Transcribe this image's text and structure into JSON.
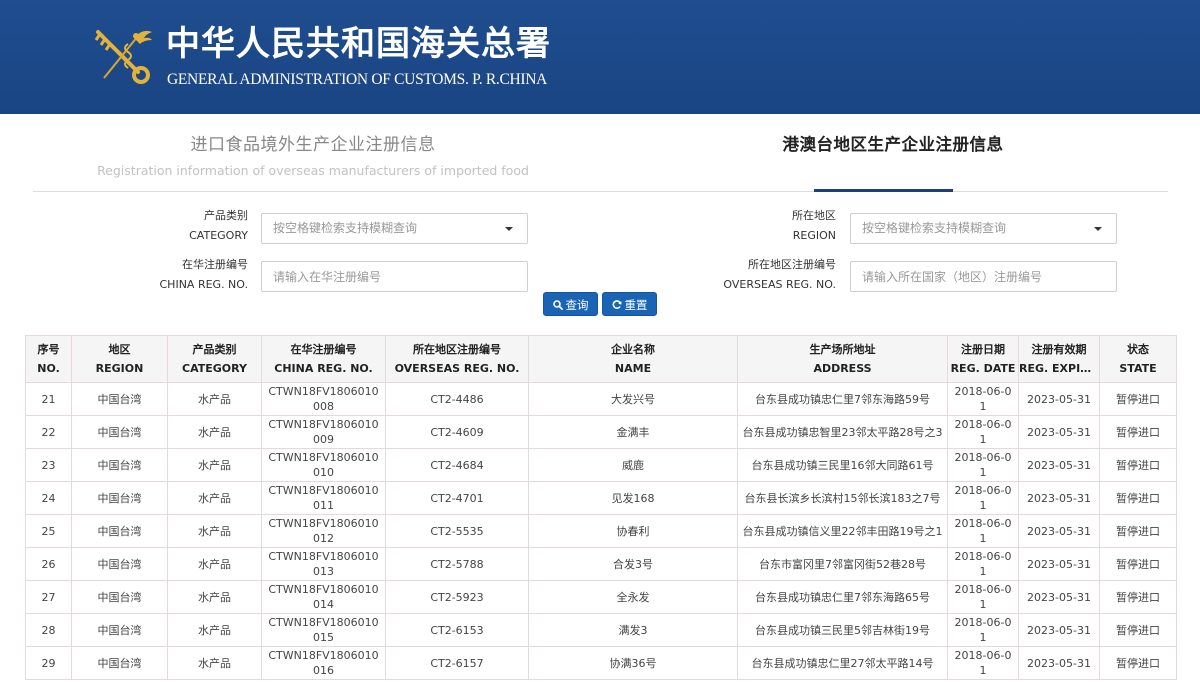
{
  "header": {
    "title_cn": "中华人民共和国海关总署",
    "title_en": "GENERAL ADMINISTRATION OF CUSTOMS. P. R.CHINA",
    "logo": "customs-emblem-icon",
    "colors": {
      "banner": "#1f4d8f",
      "logo_gold": "#e2b23a"
    }
  },
  "tabs": [
    {
      "label_cn": "进口食品境外生产企业注册信息",
      "label_en": "Registration information of overseas manufacturers of imported food",
      "active": false
    },
    {
      "label_cn": "港澳台地区生产企业注册信息",
      "label_en": "",
      "active": true
    }
  ],
  "form": {
    "category": {
      "label_cn": "产品类别",
      "label_en": "CATEGORY",
      "placeholder": "按空格键检索支持模糊查询"
    },
    "region": {
      "label_cn": "所在地区",
      "label_en": "REGION",
      "placeholder": "按空格键检索支持模糊查询"
    },
    "china_reg": {
      "label_cn": "在华注册编号",
      "label_en": "CHINA REG. NO.",
      "placeholder": "请输入在华注册编号",
      "value": ""
    },
    "overseas_reg": {
      "label_cn": "所在地区注册编号",
      "label_en": "OVERSEAS REG. NO.",
      "placeholder": "请输入所在国家（地区）注册编号",
      "value": ""
    },
    "search_button": {
      "label": "查询",
      "icon": "search-icon"
    },
    "reset_button": {
      "label": "重置",
      "icon": "refresh-icon"
    },
    "accent": "#1a64b5"
  },
  "table": {
    "columns": [
      {
        "cn": "序号",
        "en": "NO."
      },
      {
        "cn": "地区",
        "en": "REGION"
      },
      {
        "cn": "产品类别",
        "en": "CATEGORY"
      },
      {
        "cn": "在华注册编号",
        "en": "CHINA REG. NO."
      },
      {
        "cn": "所在地区注册编号",
        "en": "OVERSEAS REG. NO."
      },
      {
        "cn": "企业名称",
        "en": "NAME"
      },
      {
        "cn": "生产场所地址",
        "en": "ADDRESS"
      },
      {
        "cn": "注册日期",
        "en": "REG. DATE"
      },
      {
        "cn": "注册有效期",
        "en": "REG. EXPIR..."
      },
      {
        "cn": "状态",
        "en": "STATE"
      }
    ],
    "rows": [
      [
        "21",
        "中国台湾",
        "水产品",
        "CTWN18FV1806010008",
        "CT2-4486",
        "大发兴号",
        "台东县成功镇忠仁里7邻东海路59号",
        "2018-06-01",
        "2023-05-31",
        "暂停进口"
      ],
      [
        "22",
        "中国台湾",
        "水产品",
        "CTWN18FV1806010009",
        "CT2-4609",
        "金满丰",
        "台东县成功镇忠智里23邻太平路28号之3",
        "2018-06-01",
        "2023-05-31",
        "暂停进口"
      ],
      [
        "23",
        "中国台湾",
        "水产品",
        "CTWN18FV1806010010",
        "CT2-4684",
        "威鹿",
        "台东县成功镇三民里16邻大同路61号",
        "2018-06-01",
        "2023-05-31",
        "暂停进口"
      ],
      [
        "24",
        "中国台湾",
        "水产品",
        "CTWN18FV1806010011",
        "CT2-4701",
        "见发168",
        "台东县长滨乡长滨村15邻长滨183之7号",
        "2018-06-01",
        "2023-05-31",
        "暂停进口"
      ],
      [
        "25",
        "中国台湾",
        "水产品",
        "CTWN18FV1806010012",
        "CT2-5535",
        "协春利",
        "台东县成功镇信义里22邻丰田路19号之1",
        "2018-06-01",
        "2023-05-31",
        "暂停进口"
      ],
      [
        "26",
        "中国台湾",
        "水产品",
        "CTWN18FV1806010013",
        "CT2-5788",
        "合发3号",
        "台东市富冈里7邻富冈街52巷28号",
        "2018-06-01",
        "2023-05-31",
        "暂停进口"
      ],
      [
        "27",
        "中国台湾",
        "水产品",
        "CTWN18FV1806010014",
        "CT2-5923",
        "全永发",
        "台东县成功镇忠仁里7邻东海路65号",
        "2018-06-01",
        "2023-05-31",
        "暂停进口"
      ],
      [
        "28",
        "中国台湾",
        "水产品",
        "CTWN18FV1806010015",
        "CT2-6153",
        "满发3",
        "台东县成功镇三民里5邻吉林街19号",
        "2018-06-01",
        "2023-05-31",
        "暂停进口"
      ],
      [
        "29",
        "中国台湾",
        "水产品",
        "CTWN18FV1806010016",
        "CT2-6157",
        "协满36号",
        "台东县成功镇忠仁里27邻太平路14号",
        "2018-06-01",
        "2023-05-31",
        "暂停进口"
      ]
    ]
  }
}
